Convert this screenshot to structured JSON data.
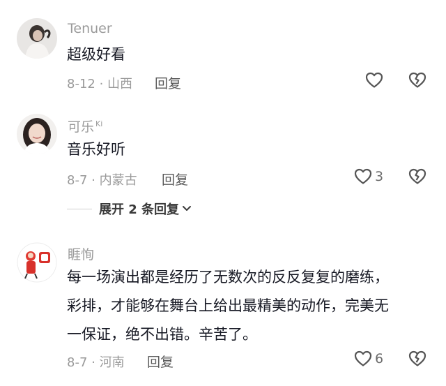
{
  "comments": [
    {
      "username": "Tenuer",
      "text": "超级好看",
      "meta": "8-12 · 山西",
      "reply_label": "回复",
      "like_count": "",
      "avatar_icon": "avatar-photo"
    },
    {
      "username": "可乐",
      "username_suffix": "Ki",
      "text": "音乐好听",
      "meta": "8-7 · 内蒙古",
      "reply_label": "回复",
      "like_count": "3",
      "expand_label": "展开 2 条回复",
      "avatar_icon": "avatar-photo"
    },
    {
      "username": "睚恂",
      "text_lines": [
        "每一场演出都是经历了无数次的反反复复的磨练，",
        "彩排，才能够在舞台上给出最精美的动作，完美无",
        "一保证，绝不出错。辛苦了。"
      ],
      "meta": "8-7 · 河南",
      "reply_label": "回复",
      "like_count": "6",
      "avatar_icon": "avatar-cartoon"
    }
  ],
  "icons": {
    "like": "heart-icon",
    "dislike": "broken-heart-icon",
    "expand": "chevron-down-icon"
  },
  "colors": {
    "primary_text": "#161823",
    "secondary_text": "#9a9a9a",
    "reply_text": "#5a5a5a",
    "background": "#ffffff"
  }
}
